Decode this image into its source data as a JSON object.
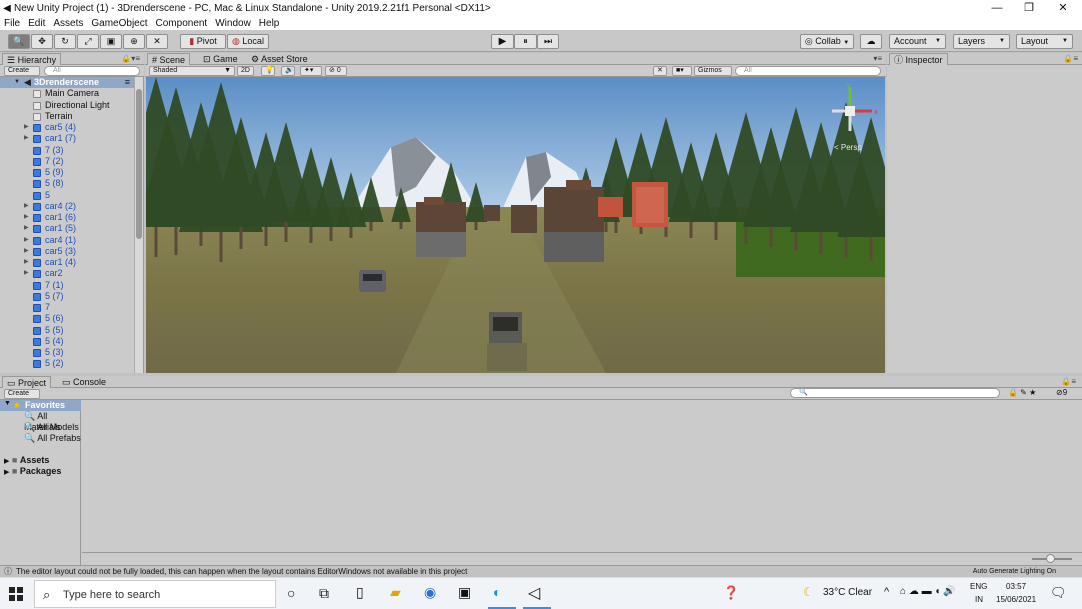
{
  "window": {
    "title": "New Unity Project (1) - 3Drenderscene - PC, Mac & Linux Standalone - Unity 2019.2.21f1 Personal <DX11>",
    "app_icon": "unity-icon",
    "minimize": "—",
    "maximize": "❐",
    "close": "✕"
  },
  "menu": [
    "File",
    "Edit",
    "Assets",
    "GameObject",
    "Component",
    "Window",
    "Help"
  ],
  "toolbar": {
    "tools": [
      "hand-tool-icon",
      "move-tool-icon",
      "rotate-tool-icon",
      "scale-tool-icon",
      "rect-tool-icon",
      "transform-tool-icon",
      "custom-tool-icon"
    ],
    "tool_glyphs": [
      "🔍",
      "✥",
      "↻",
      "⤢",
      "▣",
      "⊕",
      "✕"
    ],
    "pivot": "Pivot",
    "local": "Local",
    "play": "▶",
    "pause": "⏸",
    "step": "⏭",
    "collab": "Collab",
    "cloud": "☁",
    "account": "Account",
    "layers": "Layers",
    "layout": "Layout"
  },
  "hierarchy": {
    "tab": "Hierarchy",
    "create": "Create",
    "search_placeholder": "All",
    "scene_name": "3Drenderscene",
    "items": [
      {
        "label": "Main Camera",
        "expandable": false,
        "type": "object"
      },
      {
        "label": "Directional Light",
        "expandable": false,
        "type": "object"
      },
      {
        "label": "Terrain",
        "expandable": false,
        "type": "object"
      },
      {
        "label": "car5 (4)",
        "expandable": true,
        "type": "prefab"
      },
      {
        "label": "car1 (7)",
        "expandable": true,
        "type": "prefab"
      },
      {
        "label": "7 (3)",
        "expandable": false,
        "type": "prefab"
      },
      {
        "label": "7 (2)",
        "expandable": false,
        "type": "prefab"
      },
      {
        "label": "5 (9)",
        "expandable": false,
        "type": "prefab"
      },
      {
        "label": "5 (8)",
        "expandable": false,
        "type": "prefab"
      },
      {
        "label": "5",
        "expandable": false,
        "type": "prefab"
      },
      {
        "label": "car4 (2)",
        "expandable": true,
        "type": "prefab"
      },
      {
        "label": "car1 (6)",
        "expandable": true,
        "type": "prefab"
      },
      {
        "label": "car1 (5)",
        "expandable": true,
        "type": "prefab"
      },
      {
        "label": "car4 (1)",
        "expandable": true,
        "type": "prefab"
      },
      {
        "label": "car5 (3)",
        "expandable": true,
        "type": "prefab"
      },
      {
        "label": "car1 (4)",
        "expandable": true,
        "type": "prefab"
      },
      {
        "label": "car2",
        "expandable": true,
        "type": "prefab"
      },
      {
        "label": "7 (1)",
        "expandable": false,
        "type": "prefab"
      },
      {
        "label": "5 (7)",
        "expandable": false,
        "type": "prefab"
      },
      {
        "label": "7",
        "expandable": false,
        "type": "prefab"
      },
      {
        "label": "5 (6)",
        "expandable": false,
        "type": "prefab"
      },
      {
        "label": "5 (5)",
        "expandable": false,
        "type": "prefab"
      },
      {
        "label": "5 (4)",
        "expandable": false,
        "type": "prefab"
      },
      {
        "label": "5 (3)",
        "expandable": false,
        "type": "prefab"
      },
      {
        "label": "5 (2)",
        "expandable": false,
        "type": "prefab"
      }
    ]
  },
  "scene": {
    "tabs": [
      "Scene",
      "Game",
      "Asset Store"
    ],
    "shading": "Shaded",
    "mode_2d": "2D",
    "gizmos": "Gizmos",
    "search_placeholder": "All",
    "fx_count": "0",
    "persp_label": "< Persp"
  },
  "inspector": {
    "tab": "Inspector"
  },
  "project": {
    "tabs": [
      "Project",
      "Console"
    ],
    "create": "Create",
    "favorites": "Favorites",
    "favorite_items": [
      "All Materials",
      "All Models",
      "All Prefabs"
    ],
    "folders": [
      "Assets",
      "Packages"
    ],
    "badge_count": "9"
  },
  "status": {
    "message": "The editor layout could not be fully loaded, this can happen when the layout contains EditorWindows not available in this project",
    "right": "Auto Generate Lighting On"
  },
  "taskbar": {
    "search_placeholder": "Type here to search",
    "weather": "33°C  Clear",
    "lang_top": "ENG",
    "lang_bottom": "IN",
    "time": "03:57",
    "date": "15/06/2021"
  },
  "colors": {
    "prefab_blue": "#1f4fb5",
    "selection": "#8fa7c9",
    "sky": "#6f9fd0",
    "ground": "#7d7a45"
  }
}
